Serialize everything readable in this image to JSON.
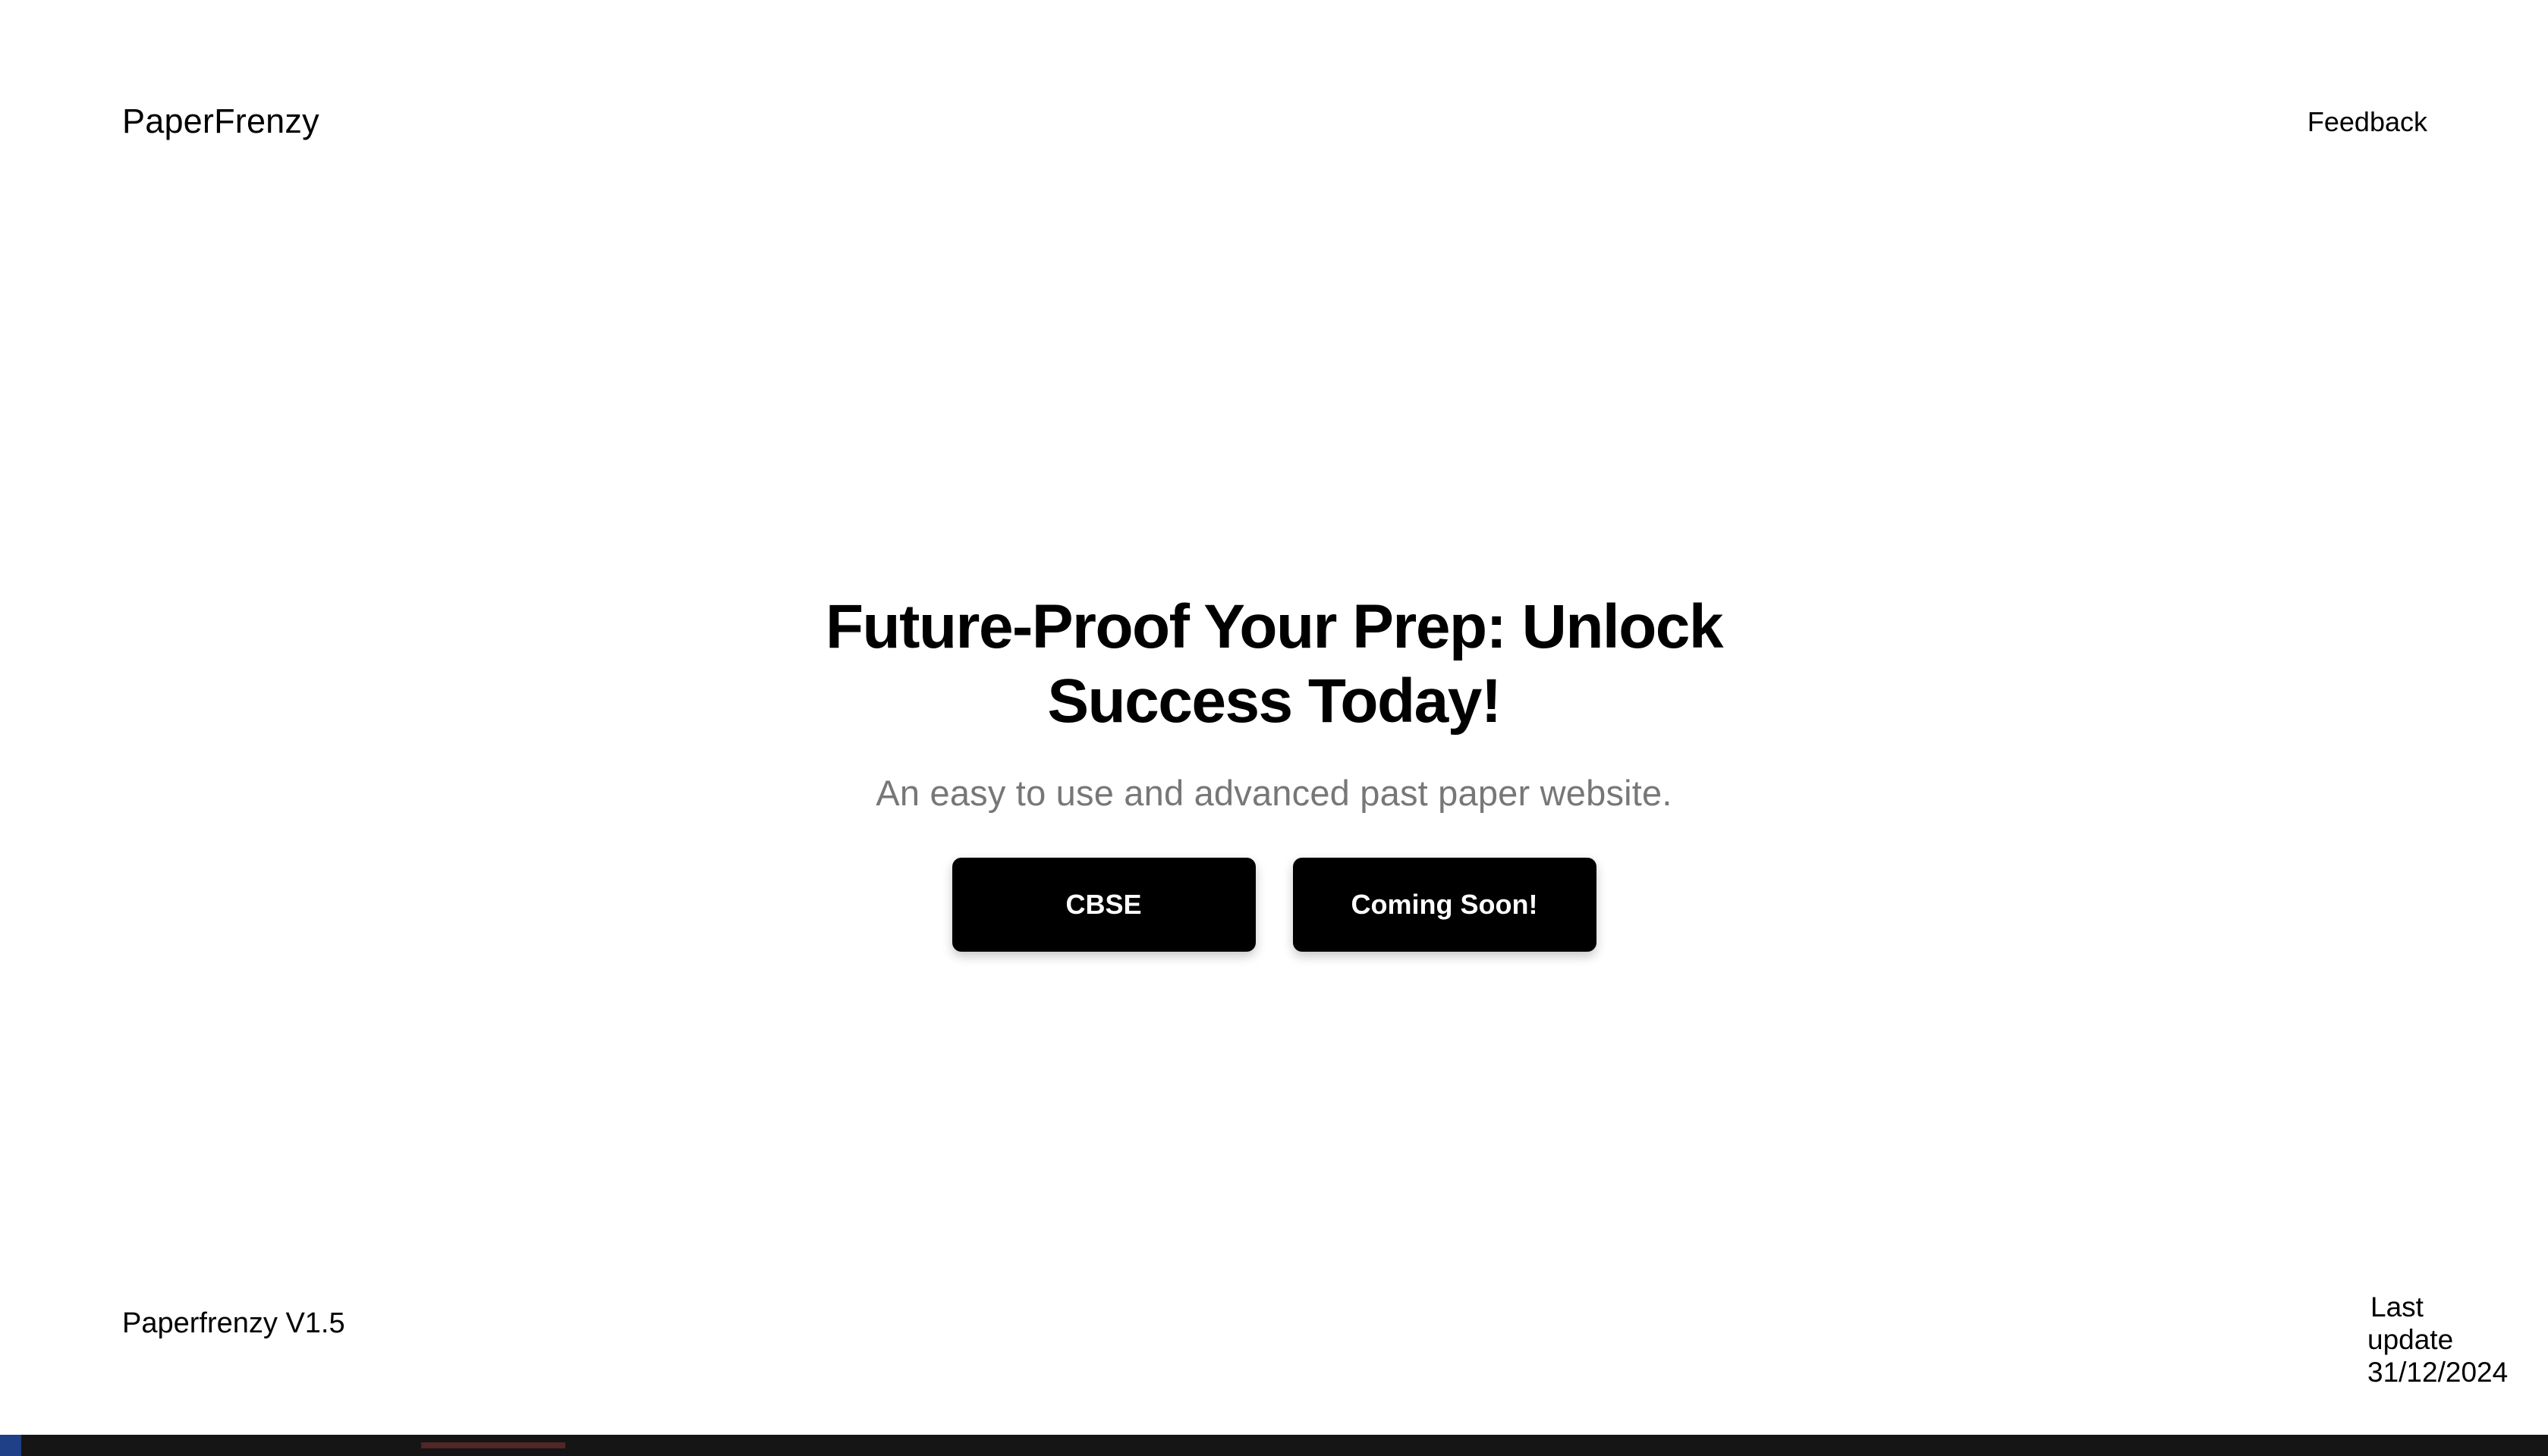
{
  "header": {
    "brand": "PaperFrenzy",
    "feedback_label": "Feedback"
  },
  "hero": {
    "title": "Future-Proof Your Prep: Unlock Success Today!",
    "subtitle": "An easy to use and advanced past paper website.",
    "buttons": [
      {
        "label": "CBSE"
      },
      {
        "label": "Coming Soon!"
      }
    ]
  },
  "footer": {
    "version": "Paperfrenzy V1.5",
    "last_update_line1": "Last",
    "last_update_line2": "update",
    "last_update_date": "31/12/2024"
  },
  "colors": {
    "background": "#ffffff",
    "text": "#000000",
    "subtitle": "#777777",
    "button_background": "#000000",
    "button_text": "#ffffff"
  }
}
